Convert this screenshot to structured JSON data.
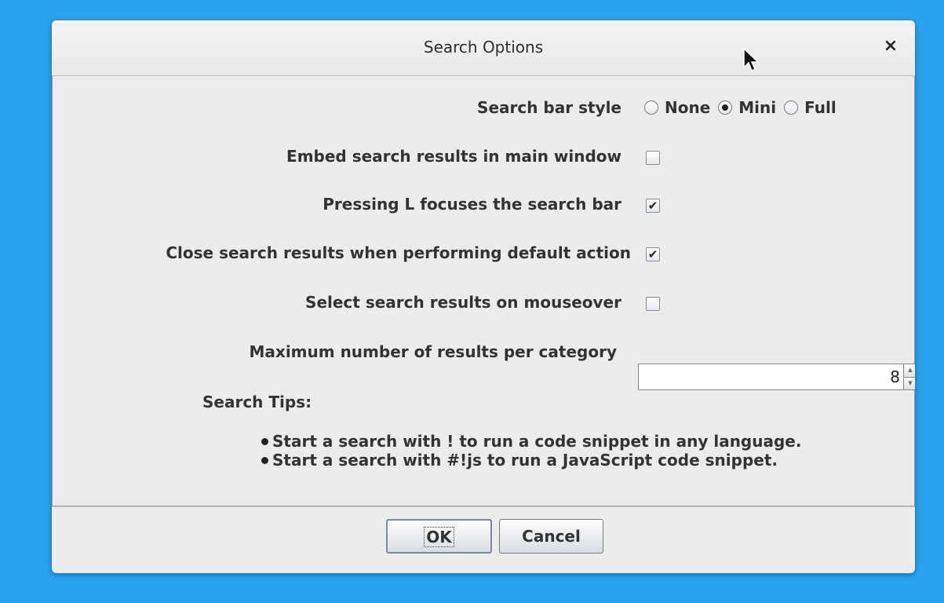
{
  "dialog": {
    "title": "Search Options",
    "close_label": "×"
  },
  "options": {
    "search_bar_style": {
      "label": "Search bar style",
      "choices": [
        "None",
        "Mini",
        "Full"
      ],
      "selected": "Mini"
    },
    "embed_results": {
      "label": "Embed search results in main window",
      "checked": false
    },
    "pressing_l": {
      "label": "Pressing L focuses the search bar",
      "checked": true
    },
    "close_results": {
      "label": "Close search results when performing default action",
      "checked": true
    },
    "select_mouseover": {
      "label": "Select search results on mouseover",
      "checked": false
    },
    "max_results": {
      "label": "Maximum number of results per category",
      "value": "8"
    }
  },
  "tips": {
    "title": "Search Tips:",
    "items": [
      "Start a search with ! to run a code snippet in any language.",
      "Start a search with #!js to run a JavaScript code snippet."
    ]
  },
  "buttons": {
    "ok": "OK",
    "cancel": "Cancel"
  },
  "checkmark": "✔"
}
